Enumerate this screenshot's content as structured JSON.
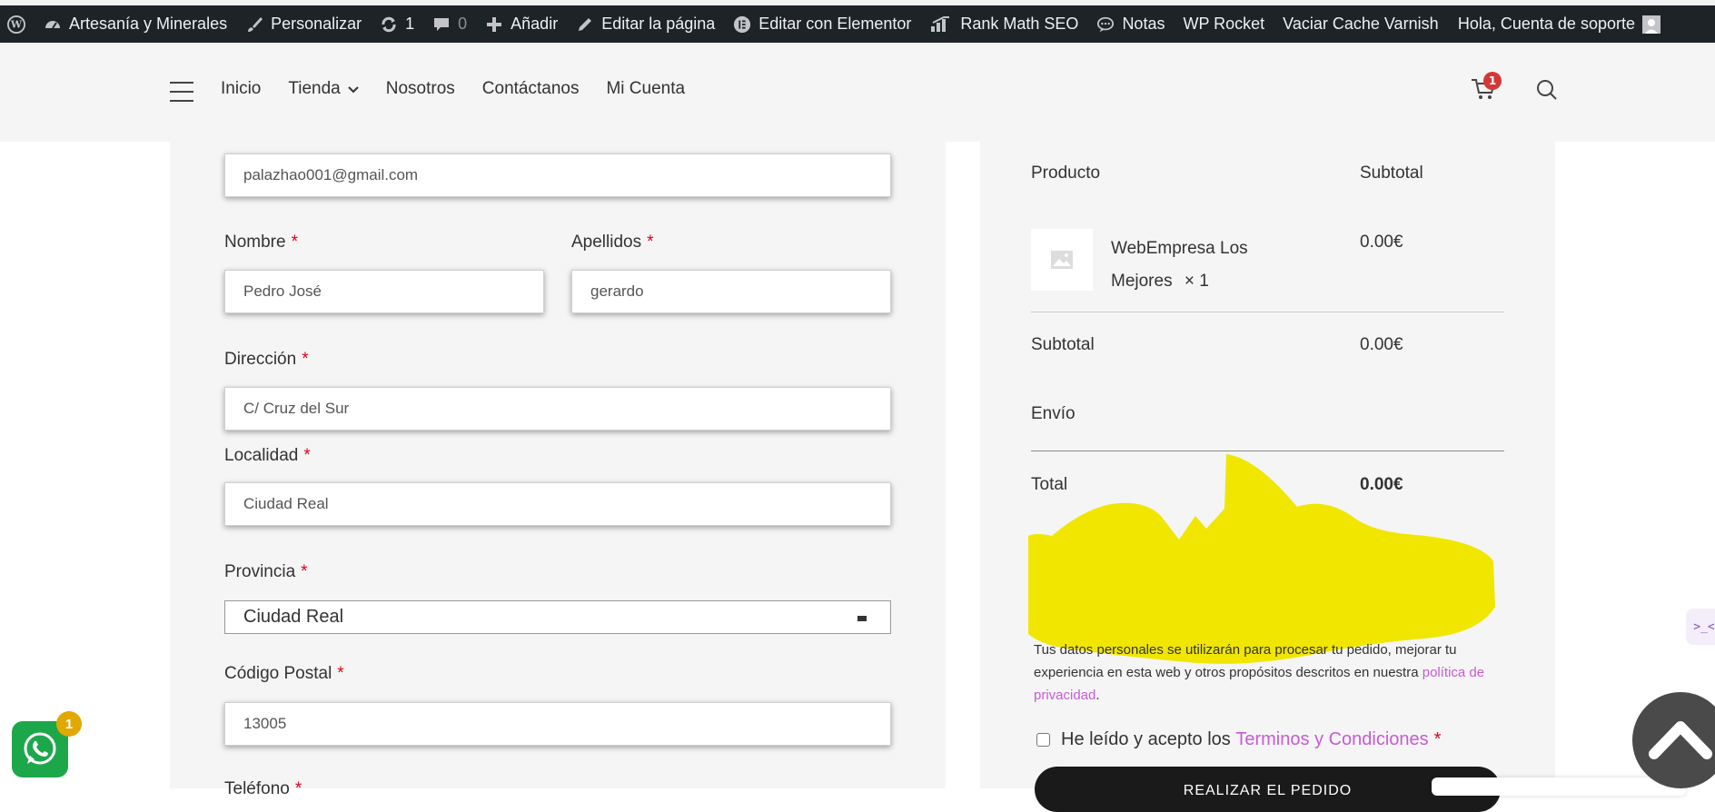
{
  "adminbar": {
    "site_name": "Artesanía y Minerales",
    "customize": "Personalizar",
    "updates_count": "1",
    "comments_count": "0",
    "add_new": "Añadir",
    "edit_page": "Editar la página",
    "edit_elementor": "Editar con Elementor",
    "rank_math": "Rank Math SEO",
    "notes": "Notas",
    "wp_rocket": "WP Rocket",
    "varnish": "Vaciar Cache Varnish",
    "greeting": "Hola, Cuenta de soporte"
  },
  "header": {
    "nav": [
      "Inicio",
      "Tienda",
      "Nosotros",
      "Contáctanos",
      "Mi Cuenta"
    ],
    "cart_count": "1"
  },
  "form": {
    "email_value": "palazhao001@gmail.com",
    "first_name_label": "Nombre",
    "first_name_value": "Pedro José",
    "last_name_label": "Apellidos",
    "last_name_value": "gerardo",
    "address_label": "Dirección",
    "address_value": "C/ Cruz del Sur",
    "city_label": "Localidad",
    "city_value": "Ciudad Real",
    "province_label": "Provincia",
    "province_value": "Ciudad Real",
    "postcode_label": "Código Postal",
    "postcode_value": "13005",
    "phone_label": "Teléfono",
    "required_mark": "*"
  },
  "order": {
    "col_product": "Producto",
    "col_subtotal": "Subtotal",
    "item_name_line1": "WebEmpresa Los",
    "item_name_line2": "Mejores",
    "item_qty": "× 1",
    "item_price": "0.00€",
    "subtotal_label": "Subtotal",
    "subtotal_value": "0.00€",
    "shipping_label": "Envío",
    "total_label": "Total",
    "total_value": "0.00€",
    "privacy_text": "Tus datos personales se utilizarán para procesar tu pedido, mejorar tu experiencia en esta web y otros propósitos descritos en nuestra ",
    "privacy_link": "política de privacidad",
    "privacy_end": ".",
    "terms_text": "He leído y acepto los ",
    "terms_link": "Terminos y Condiciones",
    "place_order": "REALIZAR EL PEDIDO"
  },
  "widgets": {
    "whatsapp_badge": "1",
    "side_tab_text": ">_<"
  },
  "colors": {
    "adminbar_bg": "#1d2327",
    "required": "#e2001a",
    "link": "#c75bd4",
    "highlight": "#f1e600",
    "whatsapp": "#1ca84a"
  }
}
